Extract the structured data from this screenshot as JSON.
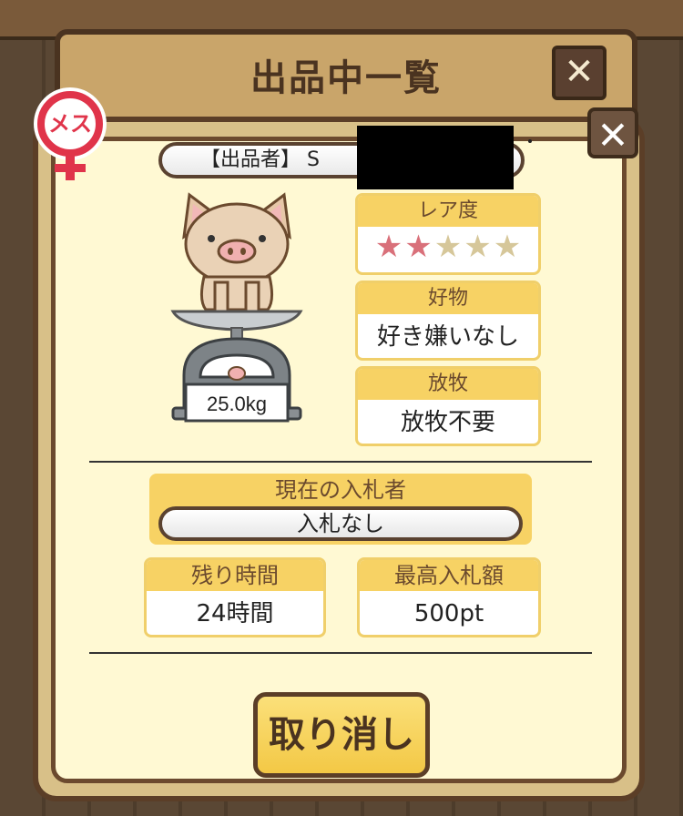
{
  "back_window": {
    "title": "出品中一覧",
    "close_label": "✕"
  },
  "modal": {
    "close_label": "✕",
    "gender_label": "メス",
    "seller": {
      "label": "【出品者】 S"
    },
    "scale_weight": "25.0kg",
    "rarity": {
      "header": "レア度",
      "filled": 2,
      "total": 5,
      "stars": [
        "★",
        "★",
        "★",
        "★",
        "★"
      ]
    },
    "favorite": {
      "header": "好物",
      "value": "好き嫌いなし"
    },
    "grazing": {
      "header": "放牧",
      "value": "放牧不要"
    },
    "current_bidder": {
      "header": "現在の入札者",
      "value": "入札なし"
    },
    "time_left": {
      "header": "残り時間",
      "value": "24時間"
    },
    "highest_bid": {
      "header": "最高入札額",
      "value": "500pt"
    },
    "cancel_button": "取り消し"
  },
  "colors": {
    "accent_yellow": "#f7d264",
    "brown": "#5b3e27",
    "star_on": "#d9707a",
    "star_off": "#d6c79a",
    "gender_red": "#e0344a"
  }
}
